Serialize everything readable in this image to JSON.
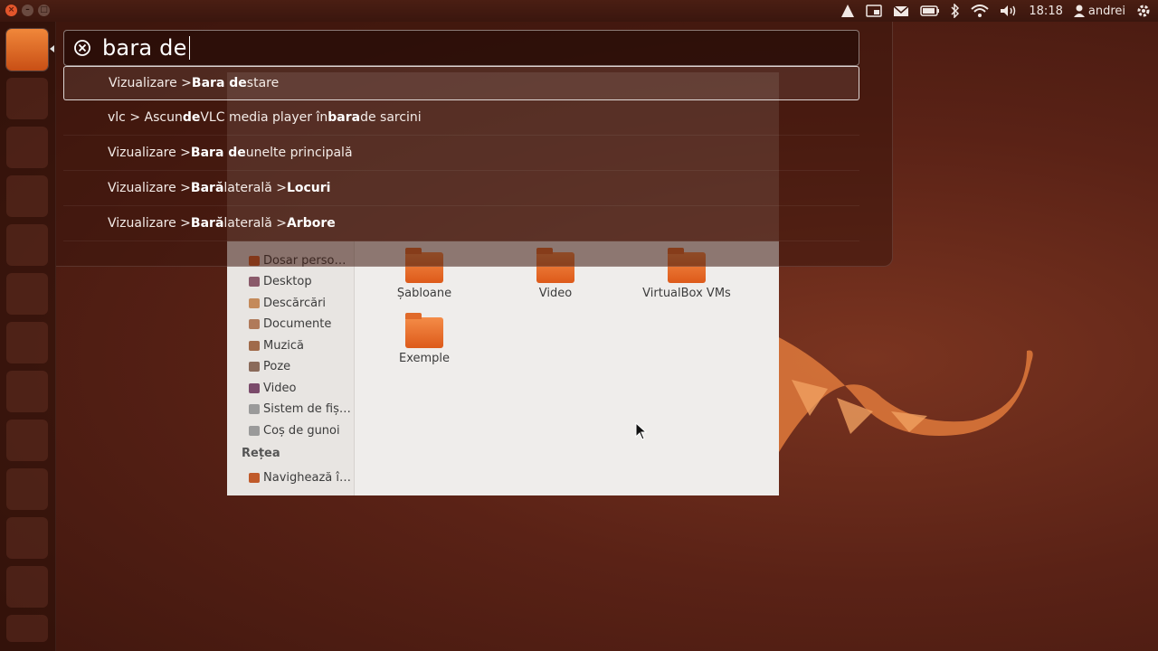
{
  "panel": {
    "clock": "18:18",
    "user": "andrei",
    "icons": [
      "ubuntu-one-icon",
      "workspace-icon",
      "mail-icon",
      "battery-icon",
      "bluetooth-icon",
      "wifi-icon",
      "volume-icon",
      "user-icon",
      "gear-icon"
    ]
  },
  "window_buttons": {
    "close": "×",
    "minimize": "–",
    "maximize": "□"
  },
  "search": {
    "query": "bara de"
  },
  "results": [
    {
      "parts": [
        {
          "t": "Vizualizare > ",
          "b": false
        },
        {
          "t": "Bara de",
          "b": true
        },
        {
          "t": " stare",
          "b": false
        }
      ],
      "selected": true
    },
    {
      "parts": [
        {
          "t": "vlc > Ascun",
          "b": false
        },
        {
          "t": "de",
          "b": true
        },
        {
          "t": " VLC media player în ",
          "b": false
        },
        {
          "t": "bara",
          "b": true
        },
        {
          "t": " de sarcini",
          "b": false
        }
      ],
      "selected": false
    },
    {
      "parts": [
        {
          "t": "Vizualizare > ",
          "b": false
        },
        {
          "t": "Bara de",
          "b": true
        },
        {
          "t": " unelte principală",
          "b": false
        }
      ],
      "selected": false
    },
    {
      "parts": [
        {
          "t": "Vizualizare > ",
          "b": false
        },
        {
          "t": "Bară",
          "b": true
        },
        {
          "t": " laterală > ",
          "b": false
        },
        {
          "t": "Locuri",
          "b": true
        }
      ],
      "selected": false
    },
    {
      "parts": [
        {
          "t": "Vizualizare > ",
          "b": false
        },
        {
          "t": "Bară",
          "b": true
        },
        {
          "t": " laterală > ",
          "b": false
        },
        {
          "t": "Arbore",
          "b": true
        }
      ],
      "selected": false
    }
  ],
  "file_manager": {
    "places": [
      {
        "label": "Dosar perso…",
        "color": "#d9622a"
      },
      {
        "label": "Desktop",
        "color": "#8a5a6a"
      },
      {
        "label": "Descărcări",
        "color": "#c48a5a"
      },
      {
        "label": "Documente",
        "color": "#b07a5a"
      },
      {
        "label": "Muzică",
        "color": "#a06a4a"
      },
      {
        "label": "Poze",
        "color": "#8a6a5a"
      },
      {
        "label": "Video",
        "color": "#7a4a6a"
      },
      {
        "label": "Sistem de fiș…",
        "color": "#9a9a9a"
      },
      {
        "label": "Coș de gunoi",
        "color": "#9a9a9a"
      }
    ],
    "network_header": "Rețea",
    "network_items": [
      {
        "label": "Navighează î…",
        "color": "#c05a2a"
      }
    ],
    "folders": [
      "Șabloane",
      "Video",
      "VirtualBox VMs",
      "Exemple"
    ]
  },
  "colors": {
    "accent": "#dd4814",
    "panel": "#3a160e"
  }
}
